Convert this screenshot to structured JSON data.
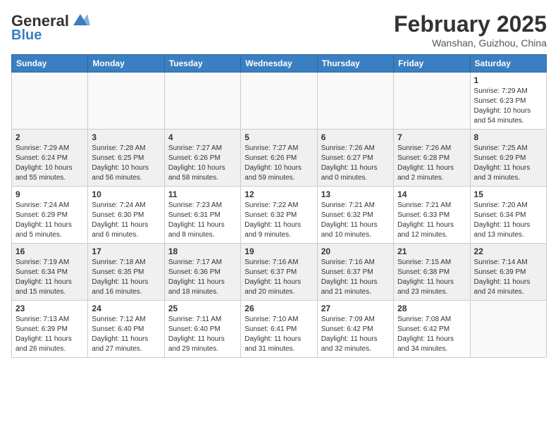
{
  "header": {
    "logo_line1": "General",
    "logo_line2": "Blue",
    "month_year": "February 2025",
    "location": "Wanshan, Guizhou, China"
  },
  "weekdays": [
    "Sunday",
    "Monday",
    "Tuesday",
    "Wednesday",
    "Thursday",
    "Friday",
    "Saturday"
  ],
  "weeks": [
    [
      {
        "day": "",
        "info": ""
      },
      {
        "day": "",
        "info": ""
      },
      {
        "day": "",
        "info": ""
      },
      {
        "day": "",
        "info": ""
      },
      {
        "day": "",
        "info": ""
      },
      {
        "day": "",
        "info": ""
      },
      {
        "day": "1",
        "info": "Sunrise: 7:29 AM\nSunset: 6:23 PM\nDaylight: 10 hours\nand 54 minutes."
      }
    ],
    [
      {
        "day": "2",
        "info": "Sunrise: 7:29 AM\nSunset: 6:24 PM\nDaylight: 10 hours\nand 55 minutes."
      },
      {
        "day": "3",
        "info": "Sunrise: 7:28 AM\nSunset: 6:25 PM\nDaylight: 10 hours\nand 56 minutes."
      },
      {
        "day": "4",
        "info": "Sunrise: 7:27 AM\nSunset: 6:26 PM\nDaylight: 10 hours\nand 58 minutes."
      },
      {
        "day": "5",
        "info": "Sunrise: 7:27 AM\nSunset: 6:26 PM\nDaylight: 10 hours\nand 59 minutes."
      },
      {
        "day": "6",
        "info": "Sunrise: 7:26 AM\nSunset: 6:27 PM\nDaylight: 11 hours\nand 0 minutes."
      },
      {
        "day": "7",
        "info": "Sunrise: 7:26 AM\nSunset: 6:28 PM\nDaylight: 11 hours\nand 2 minutes."
      },
      {
        "day": "8",
        "info": "Sunrise: 7:25 AM\nSunset: 6:29 PM\nDaylight: 11 hours\nand 3 minutes."
      }
    ],
    [
      {
        "day": "9",
        "info": "Sunrise: 7:24 AM\nSunset: 6:29 PM\nDaylight: 11 hours\nand 5 minutes."
      },
      {
        "day": "10",
        "info": "Sunrise: 7:24 AM\nSunset: 6:30 PM\nDaylight: 11 hours\nand 6 minutes."
      },
      {
        "day": "11",
        "info": "Sunrise: 7:23 AM\nSunset: 6:31 PM\nDaylight: 11 hours\nand 8 minutes."
      },
      {
        "day": "12",
        "info": "Sunrise: 7:22 AM\nSunset: 6:32 PM\nDaylight: 11 hours\nand 9 minutes."
      },
      {
        "day": "13",
        "info": "Sunrise: 7:21 AM\nSunset: 6:32 PM\nDaylight: 11 hours\nand 10 minutes."
      },
      {
        "day": "14",
        "info": "Sunrise: 7:21 AM\nSunset: 6:33 PM\nDaylight: 11 hours\nand 12 minutes."
      },
      {
        "day": "15",
        "info": "Sunrise: 7:20 AM\nSunset: 6:34 PM\nDaylight: 11 hours\nand 13 minutes."
      }
    ],
    [
      {
        "day": "16",
        "info": "Sunrise: 7:19 AM\nSunset: 6:34 PM\nDaylight: 11 hours\nand 15 minutes."
      },
      {
        "day": "17",
        "info": "Sunrise: 7:18 AM\nSunset: 6:35 PM\nDaylight: 11 hours\nand 16 minutes."
      },
      {
        "day": "18",
        "info": "Sunrise: 7:17 AM\nSunset: 6:36 PM\nDaylight: 11 hours\nand 18 minutes."
      },
      {
        "day": "19",
        "info": "Sunrise: 7:16 AM\nSunset: 6:37 PM\nDaylight: 11 hours\nand 20 minutes."
      },
      {
        "day": "20",
        "info": "Sunrise: 7:16 AM\nSunset: 6:37 PM\nDaylight: 11 hours\nand 21 minutes."
      },
      {
        "day": "21",
        "info": "Sunrise: 7:15 AM\nSunset: 6:38 PM\nDaylight: 11 hours\nand 23 minutes."
      },
      {
        "day": "22",
        "info": "Sunrise: 7:14 AM\nSunset: 6:39 PM\nDaylight: 11 hours\nand 24 minutes."
      }
    ],
    [
      {
        "day": "23",
        "info": "Sunrise: 7:13 AM\nSunset: 6:39 PM\nDaylight: 11 hours\nand 26 minutes."
      },
      {
        "day": "24",
        "info": "Sunrise: 7:12 AM\nSunset: 6:40 PM\nDaylight: 11 hours\nand 27 minutes."
      },
      {
        "day": "25",
        "info": "Sunrise: 7:11 AM\nSunset: 6:40 PM\nDaylight: 11 hours\nand 29 minutes."
      },
      {
        "day": "26",
        "info": "Sunrise: 7:10 AM\nSunset: 6:41 PM\nDaylight: 11 hours\nand 31 minutes."
      },
      {
        "day": "27",
        "info": "Sunrise: 7:09 AM\nSunset: 6:42 PM\nDaylight: 11 hours\nand 32 minutes."
      },
      {
        "day": "28",
        "info": "Sunrise: 7:08 AM\nSunset: 6:42 PM\nDaylight: 11 hours\nand 34 minutes."
      },
      {
        "day": "",
        "info": ""
      }
    ]
  ]
}
